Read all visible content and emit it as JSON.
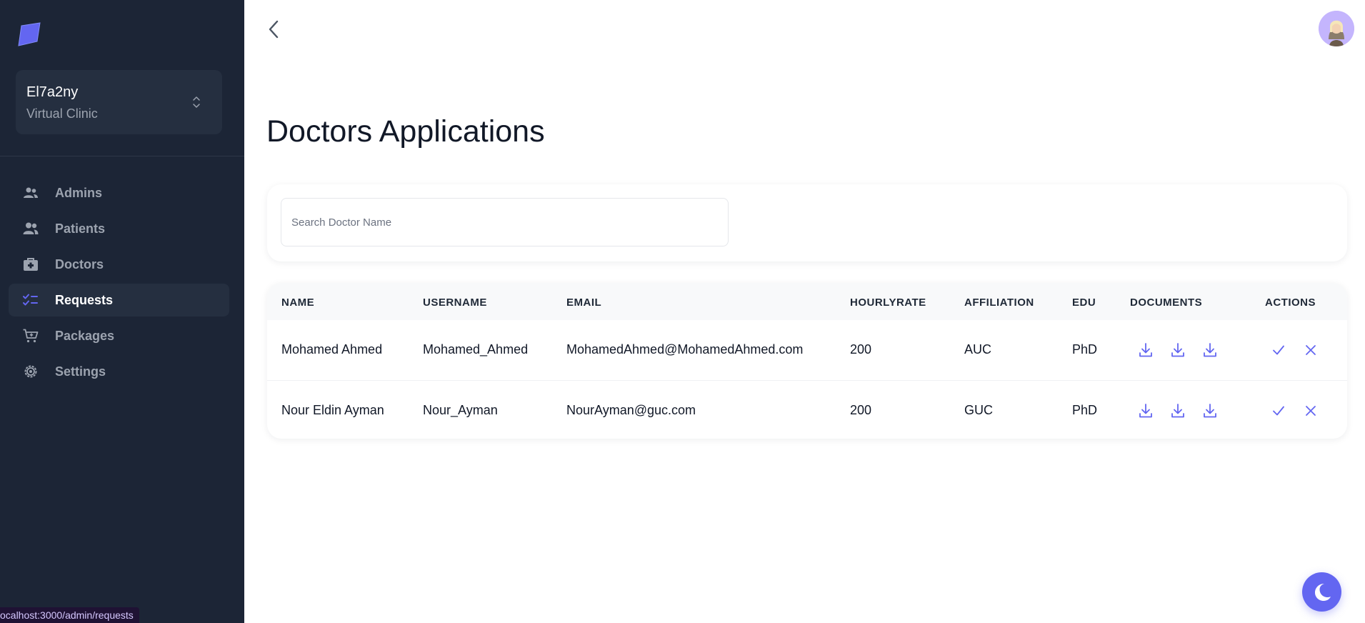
{
  "sidebar": {
    "workspace": {
      "name": "El7a2ny",
      "subtitle": "Virtual Clinic"
    },
    "items": [
      {
        "label": "Admins",
        "icon": "admins-icon"
      },
      {
        "label": "Patients",
        "icon": "patients-icon"
      },
      {
        "label": "Doctors",
        "icon": "doctors-icon"
      },
      {
        "label": "Requests",
        "icon": "requests-icon",
        "active": true
      },
      {
        "label": "Packages",
        "icon": "packages-icon"
      },
      {
        "label": "Settings",
        "icon": "settings-icon"
      }
    ]
  },
  "status_url": "ocalhost:3000/admin/requests",
  "page": {
    "title": "Doctors Applications"
  },
  "search": {
    "placeholder": "Search Doctor Name",
    "value": ""
  },
  "table": {
    "columns": [
      "NAME",
      "USERNAME",
      "EMAIL",
      "HOURLYRATE",
      "AFFILIATION",
      "EDU",
      "DOCUMENTS",
      "ACTIONS"
    ],
    "rows": [
      {
        "name": "Mohamed Ahmed",
        "username": "Mohamed_Ahmed",
        "email": "MohamedAhmed@MohamedAhmed.com",
        "hourly_rate": "200",
        "affiliation": "AUC",
        "edu": "PhD"
      },
      {
        "name": "Nour Eldin Ayman",
        "username": "Nour_Ayman",
        "email": "NourAyman@guc.com",
        "hourly_rate": "200",
        "affiliation": "GUC",
        "edu": "PhD"
      }
    ]
  },
  "colors": {
    "sidebar_bg": "#1c2536",
    "accent": "#6366f1",
    "active_item_bg": "#252f40"
  }
}
